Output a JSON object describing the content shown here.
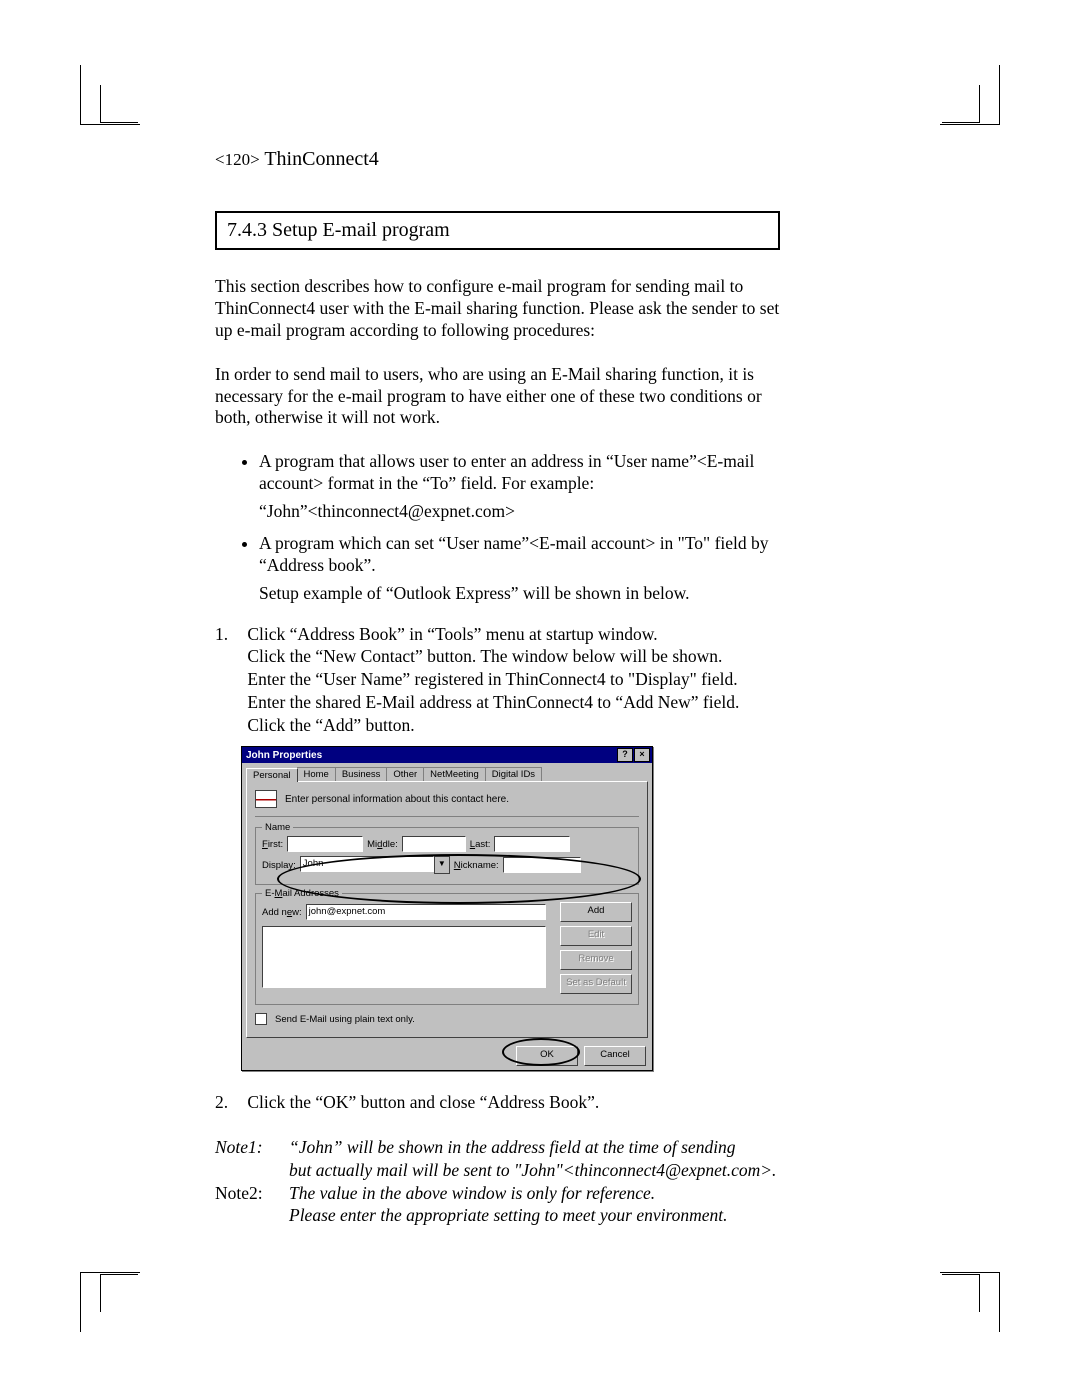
{
  "header": {
    "page_number": "<120>",
    "product": "ThinConnect4"
  },
  "section": {
    "number": "7.4.3",
    "title": "Setup E-mail program"
  },
  "paragraphs": {
    "p1": "This section describes how to configure e-mail program for sending mail to ThinConnect4 user with the E-mail sharing function.  Please ask the sender to set up e-mail program according to following procedures:",
    "p2": "In order to send mail to users, who are using an E-Mail sharing function, it is necessary for the e-mail program to have either one of these two conditions or both, otherwise it will not work."
  },
  "bullets": [
    {
      "text": "A program that allows user to enter an address in “User name”<E-mail account> format in the “To” field. For example:",
      "sub": "“John”<thinconnect4@expnet.com>"
    },
    {
      "text": "A program which can set “User name”<E-mail account> in \"To\" field by “Address book”.",
      "sub": "Setup example of “Outlook Express” will be shown in below."
    }
  ],
  "steps": {
    "s1_lines": [
      "Click “Address Book” in “Tools” menu at startup window.",
      "Click the “New Contact” button. The window below will be shown.",
      "Enter the “User Name” registered in ThinConnect4 to \"Display\" field.",
      "Enter the shared E-Mail address at ThinConnect4 to “Add New” field.",
      "Click the “Add” button."
    ],
    "s2": "Click the “OK” button and close “Address Book”."
  },
  "dialog": {
    "title": "John Properties",
    "help_btn": "?",
    "close_btn": "×",
    "tabs": [
      "Personal",
      "Home",
      "Business",
      "Other",
      "NetMeeting",
      "Digital IDs"
    ],
    "hint": "Enter personal information about this contact here.",
    "group_name": "Name",
    "labels": {
      "first": "First:",
      "middle": "Middle:",
      "last": "Last:",
      "display": "Display:",
      "nickname": "Nickname:",
      "addnew": "Add new:",
      "emails_legend": "E-Mail Addresses"
    },
    "values": {
      "display": "John",
      "addnew": "john@expnet.com"
    },
    "buttons": {
      "add": "Add",
      "edit": "Edit",
      "remove": "Remove",
      "set_default": "Set as Default",
      "ok": "OK",
      "cancel": "Cancel"
    },
    "checkbox_label": "Send E-Mail using plain text only."
  },
  "notes": {
    "n1_label": "Note1:",
    "n1_l1": "“John” will be shown in the address field at the time of sending",
    "n1_l2": "but actually mail will be sent to \"John\"<thinconnect4@expnet.com>.",
    "n2_label": "Note2:",
    "n2_l1": "The value in the above window is only for reference.",
    "n2_l2": "Please enter the appropriate setting to meet  your environment."
  }
}
